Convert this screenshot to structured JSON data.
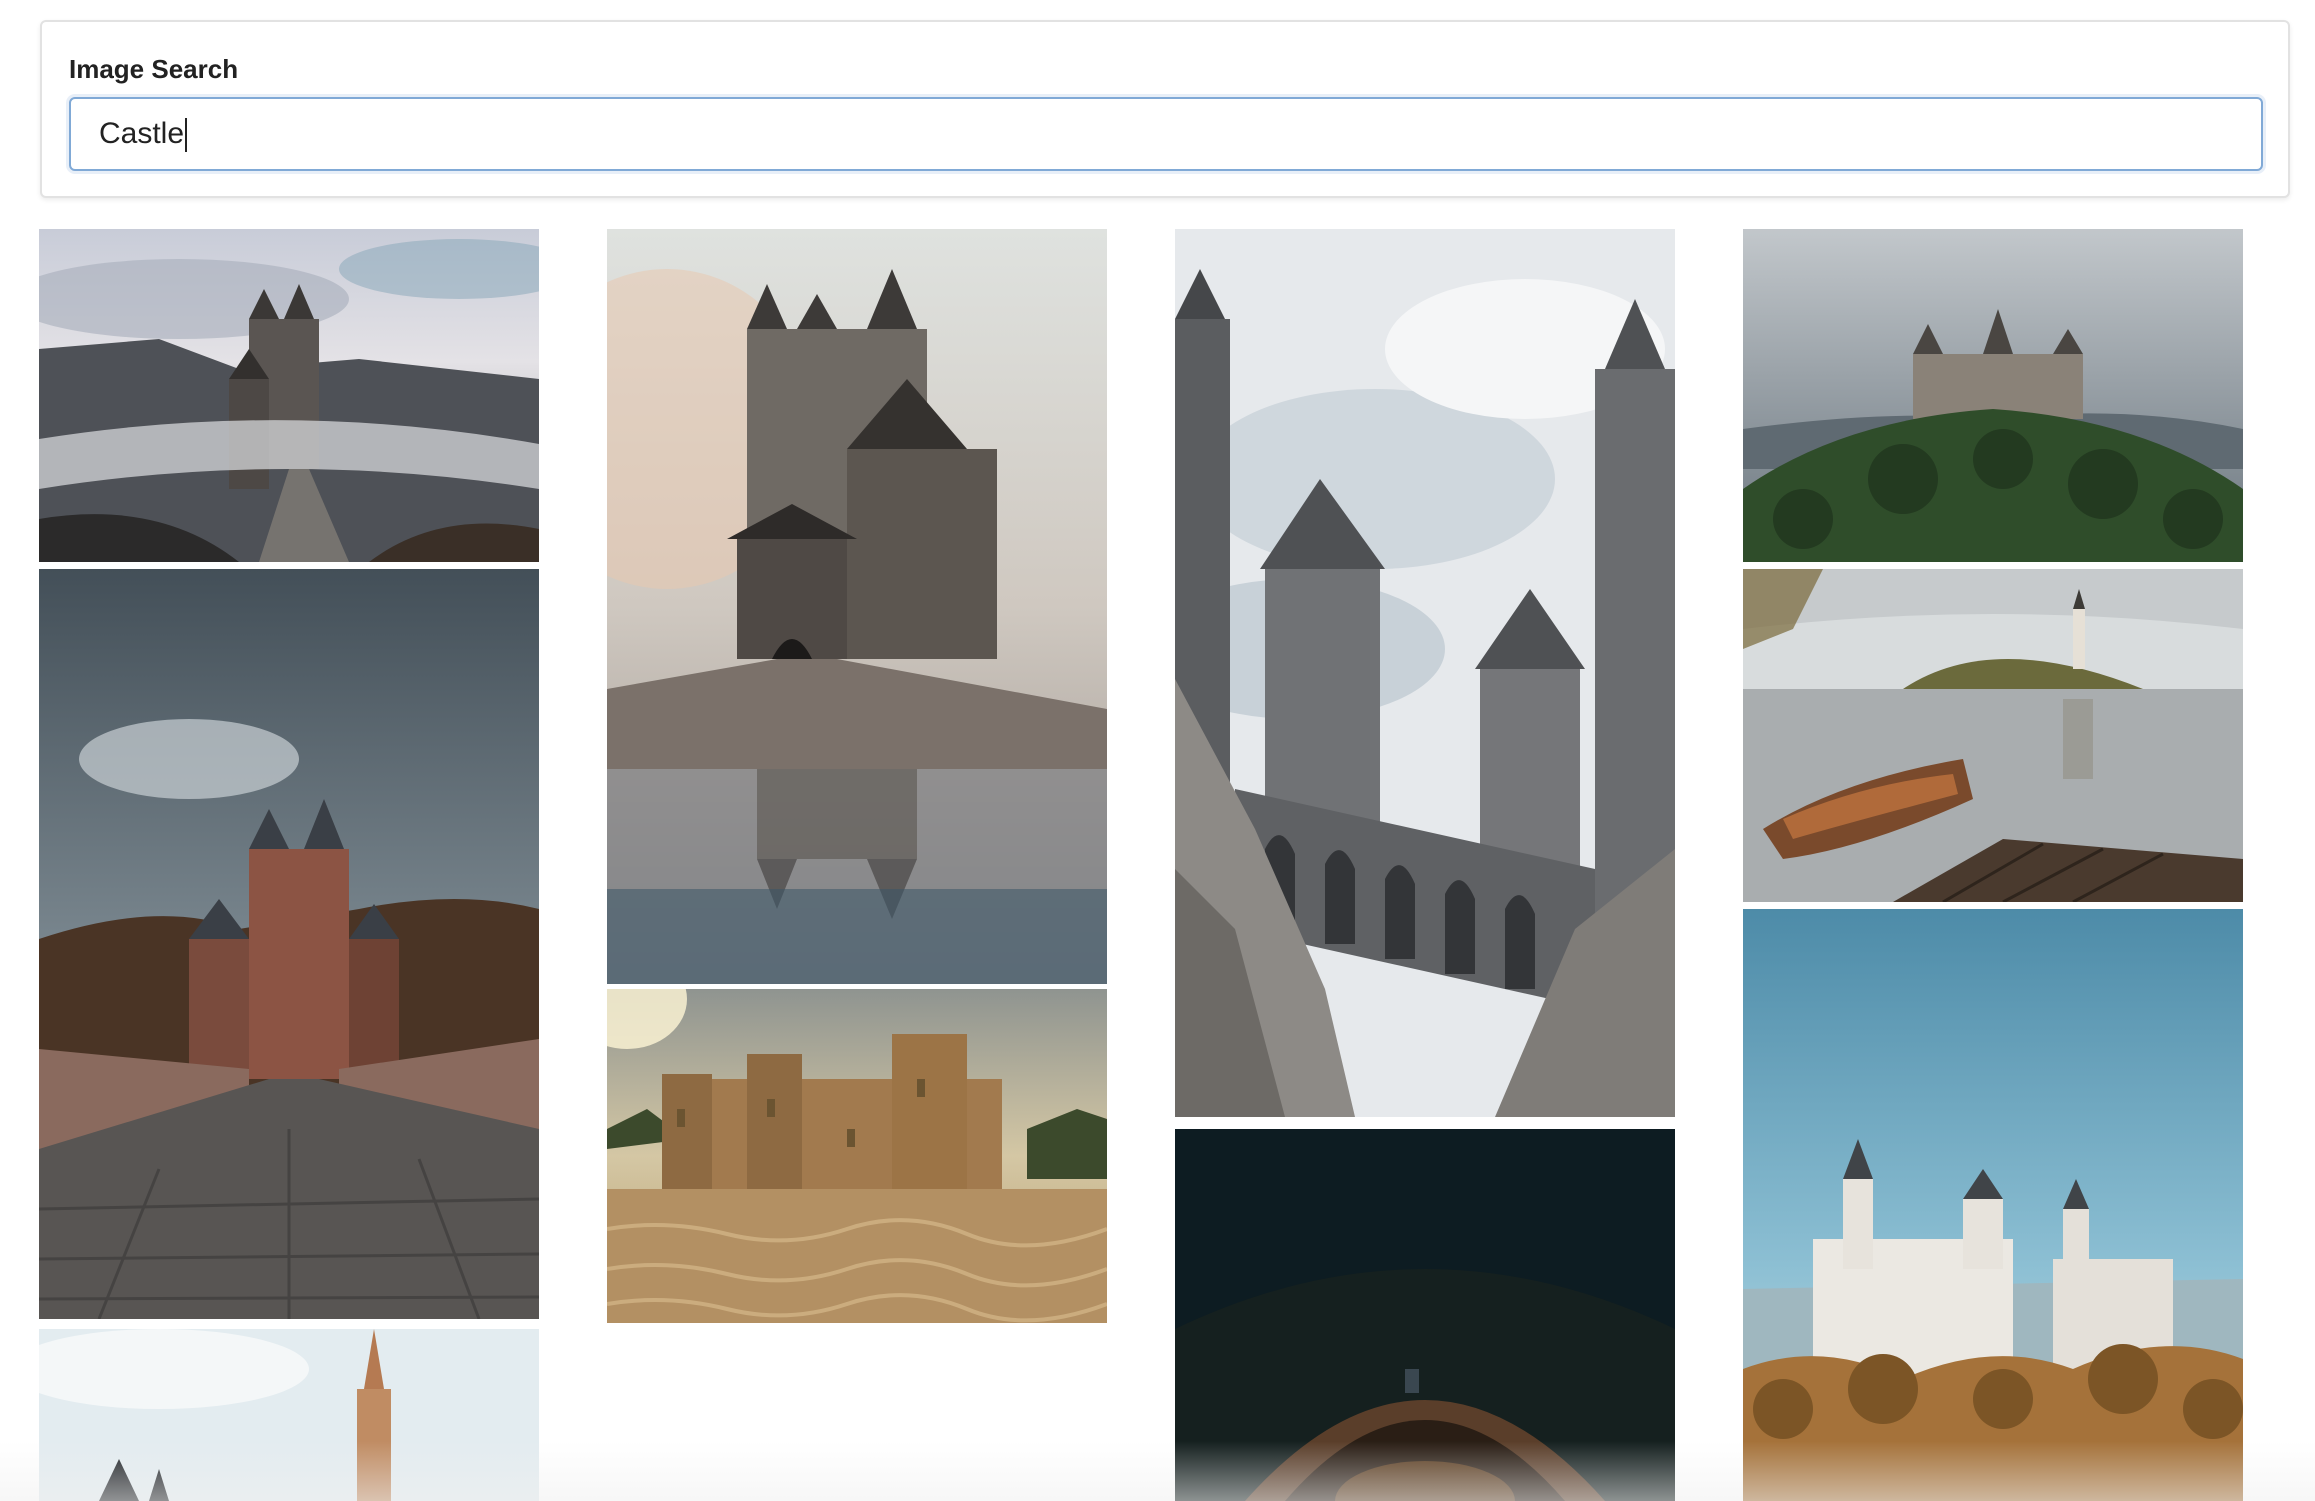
{
  "search": {
    "label": "Image Search",
    "value": "Castle"
  },
  "results": {
    "columns": [
      [
        {
          "subject": "castle-on-misty-hill-with-path",
          "palette": [
            "#cfd4dc",
            "#5c6066",
            "#2e3034"
          ]
        },
        {
          "subject": "castle-at-end-of-cobblestone-bridge",
          "palette": [
            "#5b6872",
            "#7d5a4c",
            "#3c3a38"
          ]
        },
        {
          "subject": "castle-spire-under-sky",
          "palette": [
            "#dfe8ee",
            "#b07a58",
            "#202428"
          ]
        }
      ],
      [
        {
          "subject": "castle-in-fog-with-reflection",
          "palette": [
            "#d9dcd8",
            "#6c6660",
            "#3f3a36"
          ]
        },
        {
          "subject": "moated-castle-in-golden-light",
          "palette": [
            "#b9a37c",
            "#a27a4e",
            "#6b5431"
          ]
        }
      ],
      [
        {
          "subject": "gothic-castle-towers-on-cliffs",
          "palette": [
            "#e6e9ec",
            "#6f7174",
            "#4b4d50"
          ]
        },
        {
          "subject": "dark-castle-archway-at-night",
          "palette": [
            "#0e1e24",
            "#6b4a33",
            "#1a1410"
          ]
        }
      ],
      [
        {
          "subject": "hilltop-castle-above-forest",
          "palette": [
            "#9ea6ad",
            "#3d5a36",
            "#243620"
          ]
        },
        {
          "subject": "island-church-in-lake-with-rowboat",
          "palette": [
            "#c3c7c9",
            "#7a4a2c",
            "#4a3a2e"
          ]
        },
        {
          "subject": "white-castle-above-autumn-forest",
          "palette": [
            "#5f9bb7",
            "#e9e6df",
            "#a5723a"
          ]
        }
      ]
    ]
  }
}
